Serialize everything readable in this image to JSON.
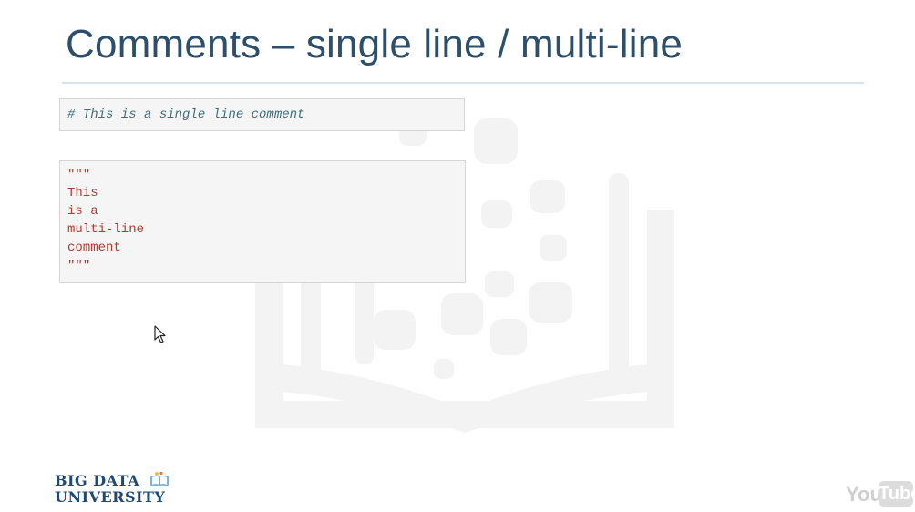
{
  "slide": {
    "title": "Comments – single line / multi-line"
  },
  "code_single": {
    "text": "# This is a single line comment"
  },
  "code_multi": {
    "lines": [
      "\"\"\"",
      "This",
      "is a",
      "multi-line",
      "comment",
      "\"\"\""
    ]
  },
  "logo": {
    "line1": "BIG DATA",
    "line2": "UNIVERSITY"
  },
  "youtube": {
    "you": "You",
    "tube": "Tube"
  },
  "icons": {
    "watermark": "open-book-watermark-icon",
    "cursor": "mouse-pointer-icon",
    "logo_mark": "book-logo-icon"
  },
  "colors": {
    "title": "#2d4f6b",
    "comment_single": "#3b6f7e",
    "comment_multi": "#b03a2e",
    "code_bg": "#f5f5f5"
  }
}
